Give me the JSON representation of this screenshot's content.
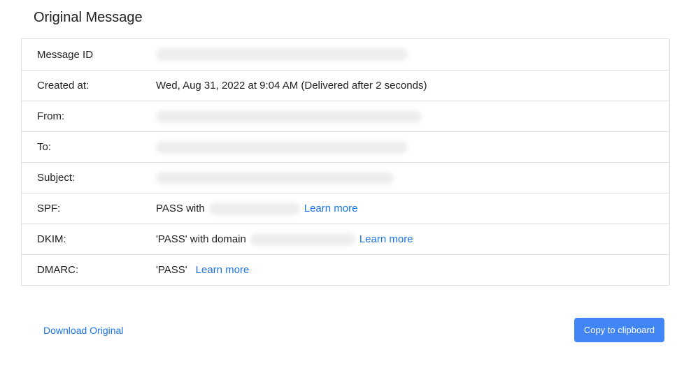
{
  "heading": "Original Message",
  "rows": {
    "message_id": {
      "label": "Message ID"
    },
    "created_at": {
      "label": "Created at:",
      "value": "Wed, Aug 31, 2022 at 9:04 AM (Delivered after 2 seconds)"
    },
    "from": {
      "label": "From:"
    },
    "to": {
      "label": "To:"
    },
    "subject": {
      "label": "Subject:"
    },
    "spf": {
      "label": "SPF:",
      "prefix": "PASS with",
      "learn_more": "Learn more"
    },
    "dkim": {
      "label": "DKIM:",
      "prefix": "'PASS' with domain",
      "learn_more": "Learn more"
    },
    "dmarc": {
      "label": "DMARC:",
      "prefix": "'PASS'",
      "learn_more": "Learn more"
    }
  },
  "footer": {
    "download": "Download Original",
    "copy": "Copy to clipboard"
  }
}
